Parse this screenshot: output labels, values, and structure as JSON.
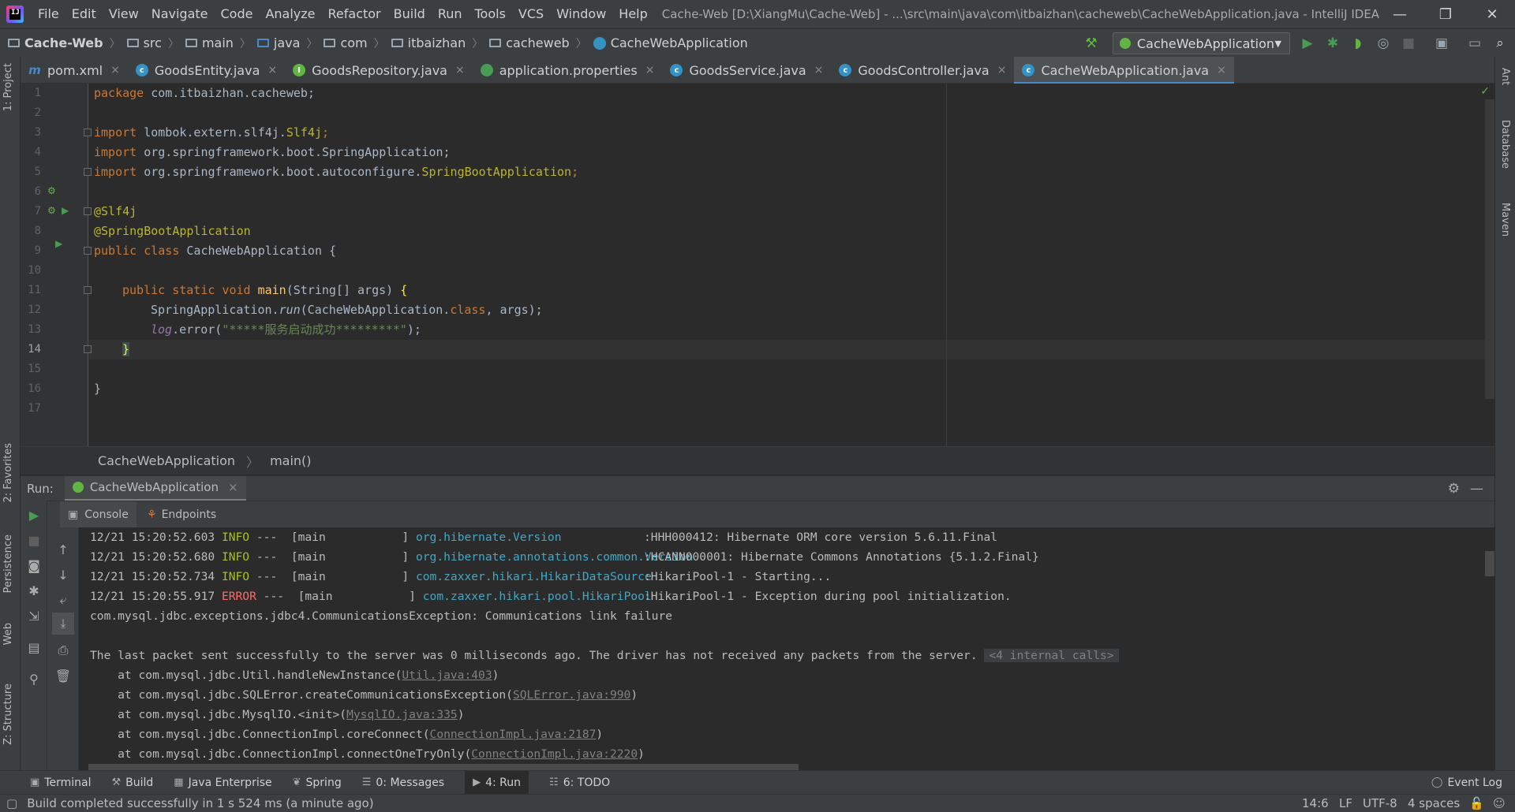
{
  "menubar": {
    "items": [
      "File",
      "Edit",
      "View",
      "Navigate",
      "Code",
      "Analyze",
      "Refactor",
      "Build",
      "Run",
      "Tools",
      "VCS",
      "Window",
      "Help"
    ],
    "title": "Cache-Web [D:\\XiangMu\\Cache-Web] - ...\\src\\main\\java\\com\\itbaizhan\\cacheweb\\CacheWebApplication.java - IntelliJ IDEA"
  },
  "navbar": {
    "crumbs": [
      "Cache-Web",
      "src",
      "main",
      "java",
      "com",
      "itbaizhan",
      "cacheweb",
      "CacheWebApplication"
    ],
    "run_config": "CacheWebApplication"
  },
  "left_stripe": {
    "project": "1: Project",
    "favorites": "2: Favorites",
    "persistence": "Persistence",
    "web": "Web",
    "structure": "Z: Structure"
  },
  "right_stripe": {
    "ant": "Ant",
    "database": "Database",
    "maven": "Maven"
  },
  "tabs": [
    {
      "label": "pom.xml",
      "icon": "m",
      "color": "#4a88c7"
    },
    {
      "label": "GoodsEntity.java",
      "icon": "c",
      "color": "#3592c4"
    },
    {
      "label": "GoodsRepository.java",
      "icon": "I",
      "color": "#62b543"
    },
    {
      "label": "application.properties",
      "icon": "p",
      "color": "#499c54"
    },
    {
      "label": "GoodsService.java",
      "icon": "c",
      "color": "#3592c4"
    },
    {
      "label": "GoodsController.java",
      "icon": "c",
      "color": "#3592c4"
    },
    {
      "label": "CacheWebApplication.java",
      "icon": "c",
      "color": "#3592c4"
    }
  ],
  "editor": {
    "line_numbers": [
      "1",
      "2",
      "3",
      "4",
      "5",
      "6",
      "7",
      "8",
      "9",
      "10",
      "11",
      "12",
      "13",
      "14",
      "15",
      "16",
      "17"
    ],
    "current_line": "14",
    "code": {
      "l1_kw": "package",
      "l1_rest": " com.itbaizhan.cacheweb;",
      "l3_kw": "import",
      "l3_rest": " lombok.extern.slf4j.",
      "l3_cls": "Slf4j",
      "l3_end": ";",
      "l4_kw": "import",
      "l4_rest": " org.springframework.boot.SpringApplication;",
      "l5_kw": "import",
      "l5_rest": " org.springframework.boot.autoconfigure.",
      "l5_cls": "SpringBootApplication",
      "l5_end": ";",
      "l7": "@Slf4j",
      "l8": "@SpringBootApplication",
      "l9_kw": "public class",
      "l9_rest": " CacheWebApplication {",
      "l11_kw": "public static void",
      "l11_fn": " main",
      "l11_rest": "(String[] args) ",
      "l11_brace": "{",
      "l12_a": "SpringApplication.",
      "l12_run": "run",
      "l12_b": "(CacheWebApplication.",
      "l12_cls": "class",
      "l12_c": ", args);",
      "l13_log": "log",
      "l13_a": ".error(",
      "l13_str": "\"*****服务启动成功*********\"",
      "l13_b": ");",
      "l14": "}",
      "l16": "}"
    }
  },
  "editor_breadcrumb": [
    "CacheWebApplication",
    "main()"
  ],
  "run_panel": {
    "label": "Run:",
    "tab": "CacheWebApplication",
    "console_tab": "Console",
    "endpoints_tab": "Endpoints"
  },
  "console": {
    "log_lines": [
      {
        "time": "12/21 15:20:52.603",
        "level": "INFO",
        "sep": " ---  [main           ] ",
        "logger": "org.hibernate.Version",
        "msg": ":HHH000412: Hibernate ORM core version 5.6.11.Final"
      },
      {
        "time": "12/21 15:20:52.680",
        "level": "INFO",
        "sep": " ---  [main           ] ",
        "logger": "org.hibernate.annotations.common.Version",
        "msg": ":HCANN000001: Hibernate Commons Annotations {5.1.2.Final}"
      },
      {
        "time": "12/21 15:20:52.734",
        "level": "INFO",
        "sep": " ---  [main           ] ",
        "logger": "com.zaxxer.hikari.HikariDataSource",
        "msg": ":HikariPool-1 - Starting..."
      },
      {
        "time": "12/21 15:20:55.917",
        "level": "ERROR",
        "sep": " ---  [main           ] ",
        "logger": "com.zaxxer.hikari.pool.HikariPool",
        "msg": ":HikariPool-1 - Exception during pool initialization."
      }
    ],
    "exception": "com.mysql.jdbc.exceptions.jdbc4.CommunicationsException: Communications link failure",
    "packet_msg": "The last packet sent successfully to the server was 0 milliseconds ago. The driver has not received any packets from the server.",
    "internal_calls": "<4 internal calls>",
    "stack": [
      {
        "at": "    at com.mysql.jdbc.Util.handleNewInstance(",
        "link": "Util.java:403",
        "end": ")"
      },
      {
        "at": "    at com.mysql.jdbc.SQLError.createCommunicationsException(",
        "link": "SQLError.java:990",
        "end": ")"
      },
      {
        "at": "    at com.mysql.jdbc.MysqlIO.<init>(",
        "link": "MysqlIO.java:335",
        "end": ")"
      },
      {
        "at": "    at com.mysql.jdbc.ConnectionImpl.coreConnect(",
        "link": "ConnectionImpl.java:2187",
        "end": ")"
      },
      {
        "at": "    at com.mysql.jdbc.ConnectionImpl.connectOneTryOnly(",
        "link": "ConnectionImpl.java:2220",
        "end": ")"
      }
    ]
  },
  "bottom_tools": {
    "terminal": "Terminal",
    "build": "Build",
    "java_enterprise": "Java Enterprise",
    "spring": "Spring",
    "messages": "0: Messages",
    "run": "4: Run",
    "todo": "6: TODO",
    "event_log": "Event Log"
  },
  "status": {
    "message": "Build completed successfully in 1 s 524 ms (a minute ago)",
    "position": "14:6",
    "line_sep": "LF",
    "encoding": "UTF-8",
    "indent": "4 spaces"
  }
}
